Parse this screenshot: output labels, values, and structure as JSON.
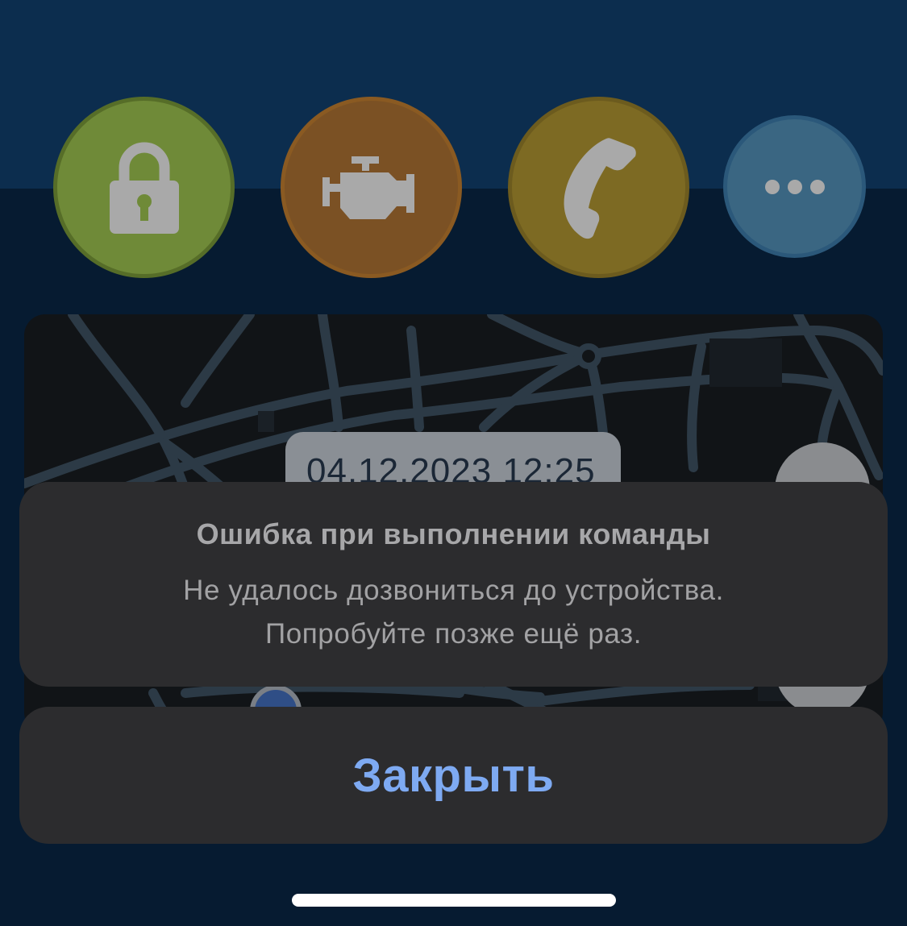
{
  "actions": [
    {
      "id": "lock",
      "icon": "lock-icon",
      "color": "#6f8a38"
    },
    {
      "id": "engine",
      "icon": "engine-icon",
      "color": "#7b5124"
    },
    {
      "id": "call",
      "icon": "phone-icon",
      "color": "#7d6a23"
    },
    {
      "id": "more",
      "icon": "more-dots-icon",
      "color": "#3a6682"
    }
  ],
  "map": {
    "timestamp": "04.12.2023 12:25"
  },
  "alert": {
    "title": "Ошибка при выполнении команды",
    "message_line1": "Не удалось дозвониться до устройства.",
    "message_line2": "Попробуйте позже ещё раз.",
    "close_label": "Закрыть"
  },
  "colors": {
    "header": "#0c2d4e",
    "background": "#061b31",
    "sheet": "#2c2c2e",
    "accent": "#7eaaf2"
  }
}
